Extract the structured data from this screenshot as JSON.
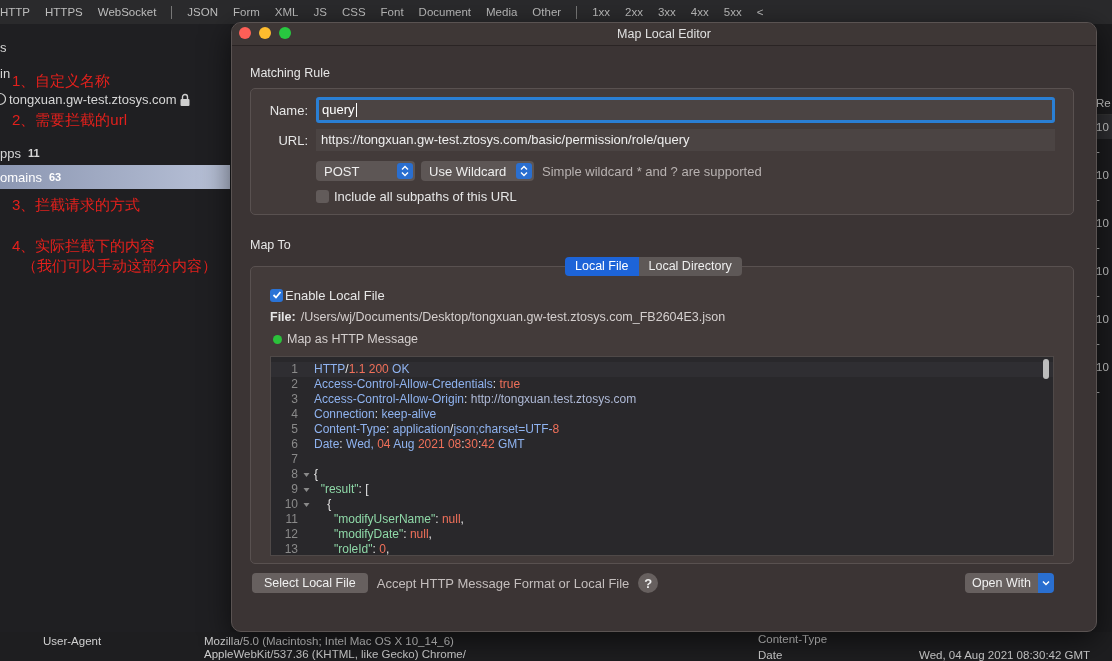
{
  "filter_bar": {
    "groups": [
      [
        "HTTP",
        "HTTPS",
        "WebSocket"
      ],
      [
        "JSON",
        "Form",
        "XML",
        "JS",
        "CSS",
        "Font",
        "Document",
        "Media",
        "Other"
      ],
      [
        "1xx",
        "2xx",
        "3xx",
        "4xx",
        "5xx"
      ]
    ],
    "collapse": "<"
  },
  "sidebar": {
    "items": [
      {
        "kind": "plain",
        "label": "s",
        "selected": false
      },
      {
        "kind": "plain",
        "label": "in",
        "selected": false
      },
      {
        "kind": "host",
        "label": "tongxuan.gw-test.ztosys.com",
        "selected": false
      },
      {
        "kind": "count",
        "label": "pps",
        "count": "11",
        "selected": false
      },
      {
        "kind": "count",
        "label": "omains",
        "count": "63",
        "selected": true
      }
    ]
  },
  "annotations": [
    "1、自定义名称",
    "2、需要拦截的url",
    "3、拦截请求的方式",
    "4、实际拦截下的内容",
    "（我们可以手动这部分内容）"
  ],
  "list_column": {
    "header": "Re",
    "cells": [
      "10",
      "-",
      "10",
      "-",
      "10",
      "-",
      "10",
      "-",
      "10",
      "-",
      "10",
      "-"
    ]
  },
  "details": {
    "left": [
      {
        "name": "User-Agent",
        "value": "Mozilla/5.0 (Macintosh; Intel Mac OS X 10_14_6)",
        "value_2": "AppleWebKit/537.36 (KHTML, like Gecko) Chrome/"
      }
    ],
    "right": [
      {
        "name": "Content-Type"
      },
      {
        "name": "Date",
        "value": "Wed, 04 Aug 2021 08:30:42 GMT"
      }
    ]
  },
  "dialog": {
    "title": "Map Local Editor",
    "matching_rule": {
      "heading": "Matching Rule",
      "name_label": "Name:",
      "name_value": "query",
      "url_label": "URL:",
      "url_value": "https://tongxuan.gw-test.ztosys.com/basic/permission/role/query",
      "method": "POST",
      "match_type": "Use Wildcard",
      "hint": "Simple wildcard * and ? are supported",
      "include_subpaths": {
        "label": "Include all subpaths of this URL",
        "checked": false
      }
    },
    "map_to": {
      "heading": "Map To",
      "tabs": [
        {
          "label": "Local File",
          "selected": true
        },
        {
          "label": "Local Directory",
          "selected": false
        }
      ],
      "enable": {
        "label": "Enable Local File",
        "checked": true
      },
      "file_label": "File:",
      "file_path": "/Users/wj/Documents/Desktop/tongxuan.gw-test.ztosys.com_FB2604E3.json",
      "http_message": {
        "label": "Map as HTTP Message",
        "color": "#2bc23b"
      },
      "code": [
        {
          "num": "1",
          "fold": false,
          "tokens": [
            {
              "text": "HTTP",
              "kind": "key"
            },
            {
              "text": "/",
              "kind": "punct"
            },
            {
              "text": "1.1 200",
              "kind": "num"
            },
            {
              "text": " OK",
              "kind": "key"
            }
          ]
        },
        {
          "num": "2",
          "fold": false,
          "tokens": [
            {
              "text": "Access-Control-Allow-Credentials",
              "kind": "key"
            },
            {
              "text": ": ",
              "kind": "punct"
            },
            {
              "text": "true",
              "kind": "num"
            }
          ]
        },
        {
          "num": "3",
          "fold": false,
          "tokens": [
            {
              "text": "Access-Control-Allow-Origin",
              "kind": "key"
            },
            {
              "text": ": ",
              "kind": "punct"
            },
            {
              "text": "http://tongxuan.test.ztosys.com",
              "kind": "url"
            }
          ]
        },
        {
          "num": "4",
          "fold": false,
          "tokens": [
            {
              "text": "Connection",
              "kind": "key"
            },
            {
              "text": ": ",
              "kind": "punct"
            },
            {
              "text": "keep-alive",
              "kind": "key"
            }
          ]
        },
        {
          "num": "5",
          "fold": false,
          "tokens": [
            {
              "text": "Content-Type",
              "kind": "key"
            },
            {
              "text": ": ",
              "kind": "punct"
            },
            {
              "text": "application",
              "kind": "key"
            },
            {
              "text": "/",
              "kind": "punct"
            },
            {
              "text": "json;charset=UTF-",
              "kind": "key"
            },
            {
              "text": "8",
              "kind": "num"
            }
          ]
        },
        {
          "num": "6",
          "fold": false,
          "tokens": [
            {
              "text": "Date",
              "kind": "key"
            },
            {
              "text": ": ",
              "kind": "punct"
            },
            {
              "text": "Wed, ",
              "kind": "key"
            },
            {
              "text": "04",
              "kind": "num"
            },
            {
              "text": " Aug ",
              "kind": "key"
            },
            {
              "text": "2021 08",
              "kind": "num"
            },
            {
              "text": ":",
              "kind": "punct"
            },
            {
              "text": "30",
              "kind": "num"
            },
            {
              "text": ":",
              "kind": "punct"
            },
            {
              "text": "42",
              "kind": "num"
            },
            {
              "text": " GMT",
              "kind": "key"
            }
          ]
        },
        {
          "num": "7",
          "fold": false
        },
        {
          "num": "8",
          "fold": true,
          "tokens": [
            {
              "text": "{",
              "kind": "punct"
            }
          ]
        },
        {
          "num": "9",
          "fold": true,
          "tokens": [
            {
              "text": "  \"result\"",
              "kind": "str"
            },
            {
              "text": ": [",
              "kind": "punct"
            }
          ]
        },
        {
          "num": "10",
          "fold": true,
          "tokens": [
            {
              "text": "    {",
              "kind": "punct"
            }
          ]
        },
        {
          "num": "11",
          "fold": false,
          "tokens": [
            {
              "text": "      \"modifyUserName\"",
              "kind": "str"
            },
            {
              "text": ": ",
              "kind": "punct"
            },
            {
              "text": "null",
              "kind": "num"
            },
            {
              "text": ",",
              "kind": "punct"
            }
          ]
        },
        {
          "num": "12",
          "fold": false,
          "tokens": [
            {
              "text": "      \"modifyDate\"",
              "kind": "str"
            },
            {
              "text": ": ",
              "kind": "punct"
            },
            {
              "text": "null",
              "kind": "num"
            },
            {
              "text": ",",
              "kind": "punct"
            }
          ]
        },
        {
          "num": "13",
          "fold": false,
          "tokens": [
            {
              "text": "      \"roleId\"",
              "kind": "str"
            },
            {
              "text": ": ",
              "kind": "punct"
            },
            {
              "text": "0",
              "kind": "num"
            },
            {
              "text": ",",
              "kind": "punct"
            }
          ]
        }
      ]
    },
    "footer": {
      "select_button": "Select Local File",
      "hint": "Accept HTTP Message Format or Local File",
      "help": "?",
      "open_with": "Open With"
    }
  }
}
